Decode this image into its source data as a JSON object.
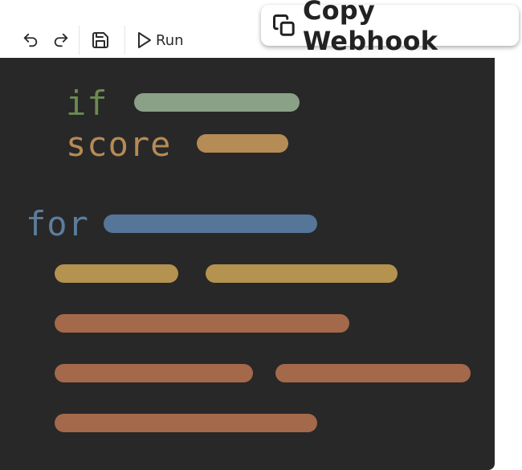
{
  "toolbar": {
    "undo_icon": "undo-icon",
    "redo_icon": "redo-icon",
    "save_icon": "save-icon",
    "run_icon": "play-icon",
    "run_label": "Run"
  },
  "copy_webhook": {
    "icon": "copy-icon",
    "label": "Copy Webhook"
  },
  "editor": {
    "keywords": {
      "if": "if",
      "score": "score",
      "for": "for"
    },
    "colors": {
      "background": "#282828",
      "if_keyword": "#6b8a52",
      "if_bar": "#8aa188",
      "score_keyword": "#b58b56",
      "score_bar": "#b58b56",
      "for_keyword": "#5d7d9a",
      "for_bar": "#557599",
      "gold_bar": "#b4924f",
      "rust_bar": "#a4684a"
    }
  }
}
